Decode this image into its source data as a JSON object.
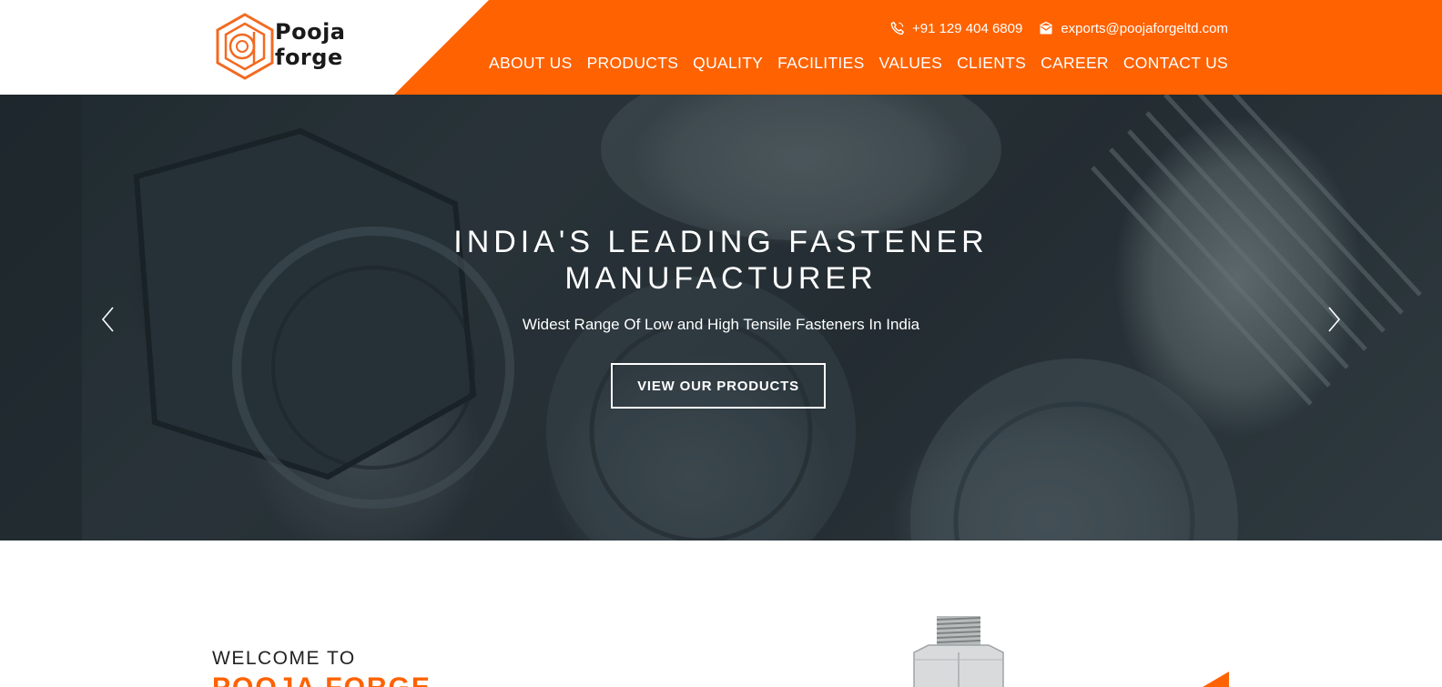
{
  "header": {
    "logo": {
      "line1": "Pooja",
      "line2": "forge"
    },
    "contact": {
      "phone": "+91 129 404 6809",
      "email": "exports@poojaforgeltd.com"
    },
    "nav": [
      {
        "label": "ABOUT US"
      },
      {
        "label": "PRODUCTS"
      },
      {
        "label": "QUALITY"
      },
      {
        "label": "FACILITIES"
      },
      {
        "label": "VALUES"
      },
      {
        "label": "CLIENTS"
      },
      {
        "label": "CAREER"
      },
      {
        "label": "CONTACT US"
      }
    ]
  },
  "hero": {
    "title": "INDIA'S LEADING FASTENER MANUFACTURER",
    "subtitle": "Widest Range Of Low and High Tensile Fasteners In India",
    "cta_label": "VIEW OUR PRODUCTS"
  },
  "welcome": {
    "pre_title": "WELCOME TO",
    "brand_title": "POOJA FORGE"
  },
  "icons": {
    "phone": "phone-icon",
    "email": "email-icon",
    "prev": "chevron-left-icon",
    "next": "chevron-right-icon"
  },
  "colors": {
    "accent": "#ff6200",
    "text_dark": "#222222",
    "white": "#ffffff"
  }
}
